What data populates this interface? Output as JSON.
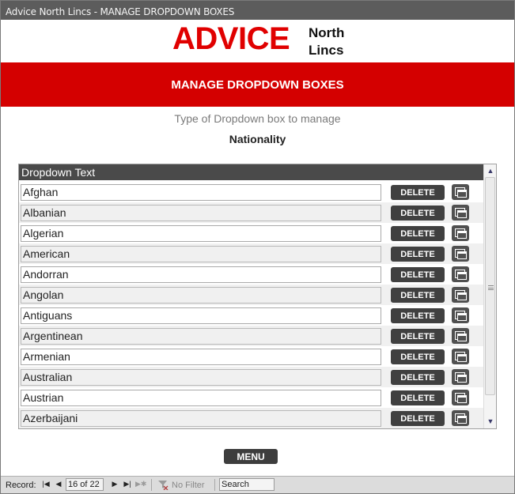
{
  "window": {
    "title": "Advice North Lincs - MANAGE DROPDOWN BOXES"
  },
  "logo": {
    "advice": "ADVICE",
    "north": "North",
    "lincs": "Lincs"
  },
  "banner": {
    "title": "MANAGE DROPDOWN BOXES"
  },
  "type_section": {
    "label": "Type of Dropdown box to manage",
    "value": "Nationality"
  },
  "list": {
    "header": "Dropdown Text",
    "delete_label": "DELETE",
    "rows": [
      "Afghan",
      "Albanian",
      "Algerian",
      "American",
      "Andorran",
      "Angolan",
      "Antiguans",
      "Argentinean",
      "Armenian",
      "Australian",
      "Austrian",
      "Azerbaijani"
    ]
  },
  "menu_button": {
    "label": "MENU"
  },
  "statusbar": {
    "record_label": "Record:",
    "position": "16 of 22",
    "filter_label": "No Filter",
    "search_placeholder": "Search"
  },
  "icons": {
    "first_record": "first-record-icon",
    "prev_record": "previous-record-icon",
    "next_record": "next-record-icon",
    "last_record": "last-record-icon",
    "new_record": "new-record-icon",
    "filter": "no-filter-icon",
    "copy": "copy-icon"
  },
  "colors": {
    "brand_red": "#d40000",
    "logo_red": "#e00000",
    "button_dark": "#404040"
  }
}
